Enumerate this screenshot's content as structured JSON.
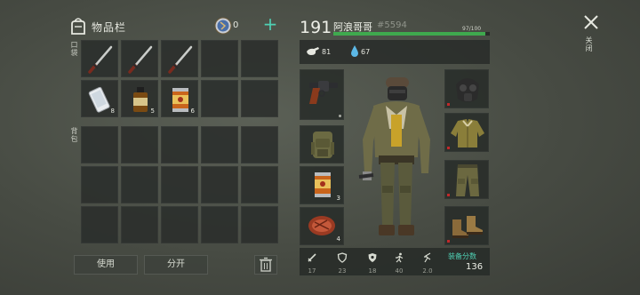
{
  "inventory": {
    "title": "物品栏",
    "coin_count": "0",
    "add_coin_symbol": "+",
    "pocket_label": "口袋",
    "backpack_label": "背包",
    "pocket_items": [
      {
        "icon": "katana-icon",
        "count": ""
      },
      {
        "icon": "katana-icon",
        "count": ""
      },
      {
        "icon": "katana-icon",
        "count": ""
      },
      {
        "icon": "",
        "count": ""
      },
      {
        "icon": "",
        "count": ""
      },
      {
        "icon": "smartphone-icon",
        "count": "8"
      },
      {
        "icon": "medicine-bottle-icon",
        "count": "5"
      },
      {
        "icon": "canned-food-icon",
        "count": "6"
      },
      {
        "icon": "",
        "count": ""
      },
      {
        "icon": "",
        "count": ""
      }
    ],
    "use_label": "使用",
    "split_label": "分开"
  },
  "character": {
    "level": "191",
    "name": "阿浪哥哥",
    "id": "#5594",
    "hp_text": "97/100",
    "hp_fraction": 0.97,
    "food": "81",
    "water": "67",
    "left_slots": [
      {
        "icon": "revolver-icon",
        "count": ""
      },
      {
        "icon": "backpack-icon",
        "count": ""
      },
      {
        "icon": "canned-food-icon",
        "count": "3"
      },
      {
        "icon": "steak-icon",
        "count": "4"
      }
    ],
    "right_slots": [
      {
        "icon": "gas-mask-icon"
      },
      {
        "icon": "jacket-icon"
      },
      {
        "icon": "pants-icon"
      },
      {
        "icon": "boots-icon"
      }
    ],
    "stats": [
      {
        "icon": "sword-icon",
        "value": "17"
      },
      {
        "icon": "shield-icon",
        "value": "23"
      },
      {
        "icon": "radiation-shield-icon",
        "value": "18"
      },
      {
        "icon": "running-icon",
        "value": "40"
      },
      {
        "icon": "speed-icon",
        "value": "2.0"
      }
    ],
    "score_label": "装备分数",
    "score": "136"
  },
  "close_label": "关闭",
  "colors": {
    "accent": "#4fd0b4",
    "hp": "#3fa94e",
    "marker": "#c0282a"
  }
}
